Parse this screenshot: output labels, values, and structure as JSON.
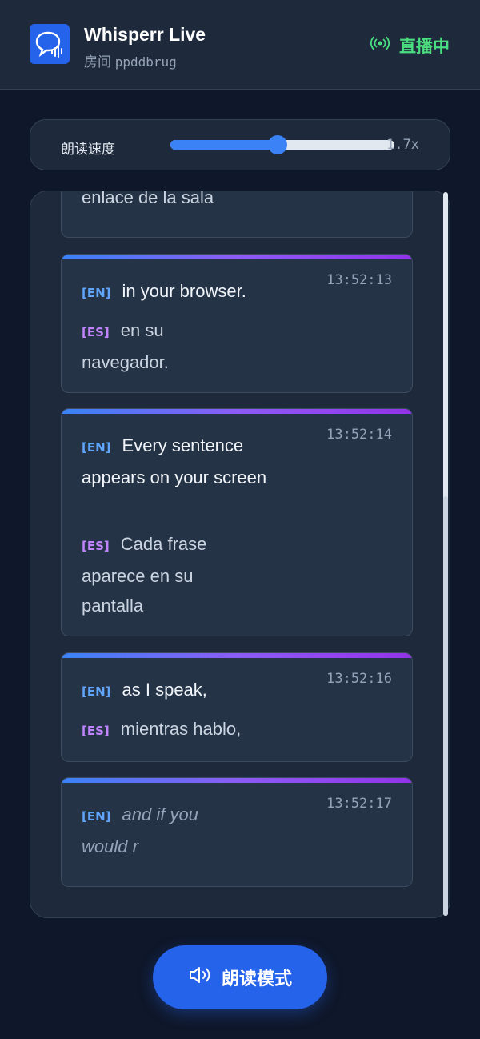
{
  "header": {
    "app_title": "Whisperr Live",
    "room_label": "房间",
    "room_code": "ppddbrug",
    "live_status": "直播中",
    "logo_icon": "chat-bubble-waveform-icon",
    "live_icon": "broadcast-icon"
  },
  "speed": {
    "label": "朗读速度",
    "value_text": "1.7x",
    "slider_fraction": 0.48
  },
  "transcript": {
    "partial_card_text": "enlace de la sala",
    "entries": [
      {
        "time": "13:52:13",
        "en_tag": "[EN]",
        "en": "in your browser.",
        "es_tag": "[ES]",
        "es": "en su navegador."
      },
      {
        "time": "13:52:14",
        "en_tag": "[EN]",
        "en": "Every sentence appears on your screen",
        "es_tag": "[ES]",
        "es": "Cada frase aparece en su pantalla"
      },
      {
        "time": "13:52:16",
        "en_tag": "[EN]",
        "en": "as I speak,",
        "es_tag": "[ES]",
        "es": "mientras hablo,"
      },
      {
        "time": "13:52:17",
        "en_tag": "[EN]",
        "en": "and if you would r"
      }
    ]
  },
  "read_mode": {
    "label": "朗读模式",
    "icon": "speaker-icon"
  },
  "colors": {
    "background": "#0f172a",
    "accent": "#2563eb",
    "live": "#4ade80",
    "en_tag": "#60a5fa",
    "es_tag": "#c084fc"
  }
}
